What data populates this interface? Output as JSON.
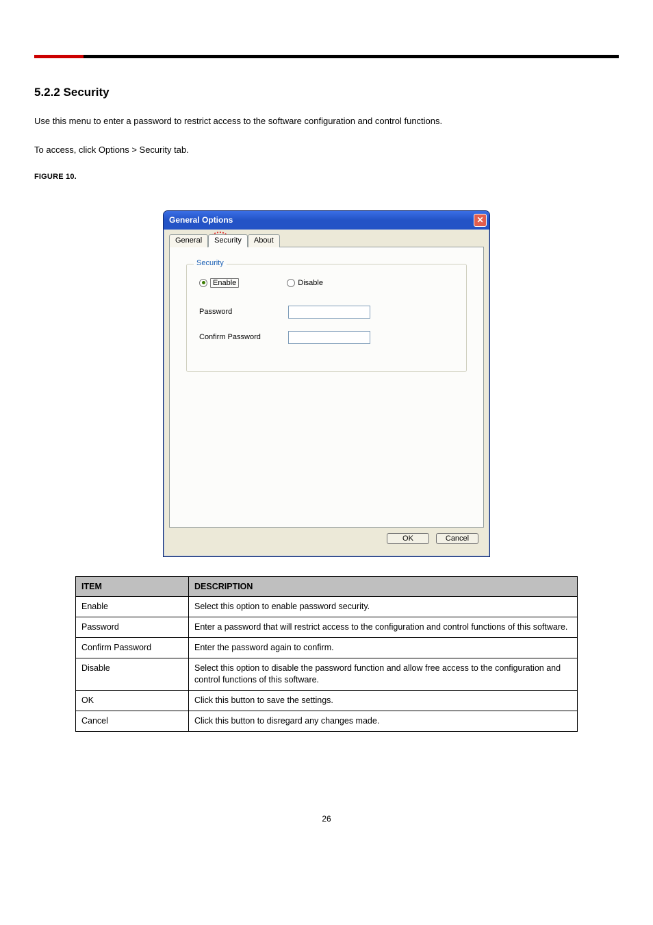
{
  "section": {
    "heading": "5.2.2 Security",
    "paragraph1": "Use this menu to enter a password to restrict access to the software configuration and control functions.",
    "paragraph2": "To access, click Options > Security tab.",
    "figure_label": "FIGURE 10."
  },
  "dialog": {
    "title": "General Options",
    "tabs": [
      "General",
      "Security",
      "About"
    ],
    "active_tab": "Security",
    "group_title": "Security",
    "radio_enable": "Enable",
    "radio_disable": "Disable",
    "password_label": "Password",
    "confirm_label": "Confirm Password",
    "ok": "OK",
    "cancel": "Cancel"
  },
  "table": {
    "head_item": "ITEM",
    "head_desc": "DESCRIPTION",
    "rows": [
      {
        "item": "Enable",
        "desc": "Select this option to enable password security."
      },
      {
        "item": "Password",
        "desc": "Enter a password that will restrict access to the configuration and control functions of this software."
      },
      {
        "item": "Confirm Password",
        "desc": "Enter the password again to confirm."
      },
      {
        "item": "Disable",
        "desc": "Select this option to disable the password function and allow free access to the configuration and control functions of this software."
      },
      {
        "item": "OK",
        "desc": "Click this button to save the settings."
      },
      {
        "item": "Cancel",
        "desc": "Click this button to disregard any changes made."
      }
    ]
  },
  "page_number": "26"
}
